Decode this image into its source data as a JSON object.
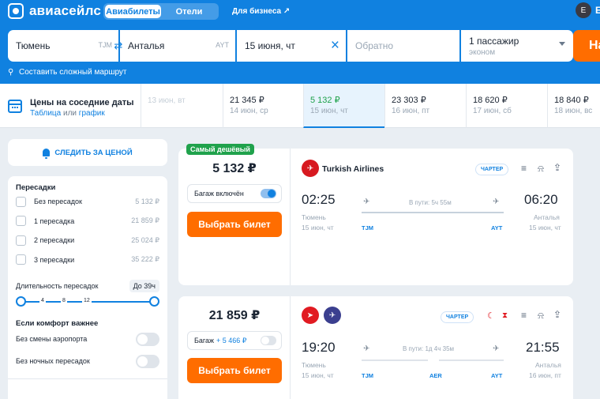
{
  "header": {
    "logo_text": "авиасейлс",
    "tabs": [
      "Авиабилеты",
      "Отели"
    ],
    "business_link": "Для бизнеса ↗",
    "avatar_initial": "Е",
    "user_name_partial": "Е"
  },
  "search": {
    "from_city": "Тюмень",
    "from_code": "TJM",
    "to_city": "Анталья",
    "to_code": "AYT",
    "date": "15 июня, чт",
    "return_placeholder": "Обратно",
    "passengers": "1 пассажир",
    "cabin_class": "эконом",
    "search_button": "На",
    "complex_route": "Составить сложный маршрут"
  },
  "nearby_dates": {
    "title": "Цены на соседние даты",
    "sub_table": "Таблица",
    "sub_or": " или ",
    "sub_chart": "график",
    "cells": [
      {
        "price": "",
        "day": "13 июн, вт"
      },
      {
        "price": "21 345 ₽",
        "day": "14 июн, ср"
      },
      {
        "price": "5 132 ₽",
        "day": "15 июн, чт"
      },
      {
        "price": "23 303 ₽",
        "day": "16 июн, пт"
      },
      {
        "price": "18 620 ₽",
        "day": "17 июн, сб"
      },
      {
        "price": "18 840 ₽",
        "day": "18 июн, вс"
      }
    ]
  },
  "sidebar": {
    "subscribe_label": "СЛЕДИТЬ ЗА ЦЕНОЙ",
    "stops_title": "Пересадки",
    "stops": [
      {
        "label": "Без пересадок",
        "price": "5 132 ₽"
      },
      {
        "label": "1 пересадка",
        "price": "21 859 ₽"
      },
      {
        "label": "2 пересадки",
        "price": "25 024 ₽"
      },
      {
        "label": "3 пересадки",
        "price": "35 222 ₽"
      }
    ],
    "duration_label": "Длительность пересадок",
    "duration_badge": "До 39ч",
    "slider_ticks": [
      "4",
      "8",
      "12"
    ],
    "comfort_title": "Если комфорт важнее",
    "comfort_toggles": [
      "Без смены аэропорта",
      "Без ночных пересадок"
    ]
  },
  "tickets": [
    {
      "badge": "Самый дешёвый",
      "price": "5 132 ₽",
      "bag_label": "Багаж включён",
      "buy_label": "Выбрать билет",
      "airline": "Turkish Airlines",
      "charter": "ЧАРТЕР",
      "dep_time": "02:25",
      "arr_time": "06:20",
      "duration": "В пути: 5ч 55м",
      "dep_city": "Тюмень",
      "dep_date": "15 июн, чт",
      "arr_city": "Анталья",
      "arr_date": "15 июн, чт",
      "dep_code": "TJM",
      "arr_code": "AYT"
    },
    {
      "price": "21 859 ₽",
      "bag_label": "Багаж",
      "bag_plus": "+ 5 466 ₽",
      "buy_label": "Выбрать билет",
      "charter": "ЧАРТЕР",
      "dep_time": "19:20",
      "arr_time": "21:55",
      "duration": "В пути: 1д 4ч 35м",
      "dep_city": "Тюмень",
      "dep_date": "15 июн, чт",
      "arr_city": "Анталья",
      "arr_date": "16 июн, пт",
      "dep_code": "TJM",
      "via_code": "AER",
      "arr_code": "AYT"
    }
  ],
  "colors": {
    "brand_blue": "#1081e0",
    "accent_orange": "#ff6d00",
    "cheapest_green": "#20a24c"
  }
}
